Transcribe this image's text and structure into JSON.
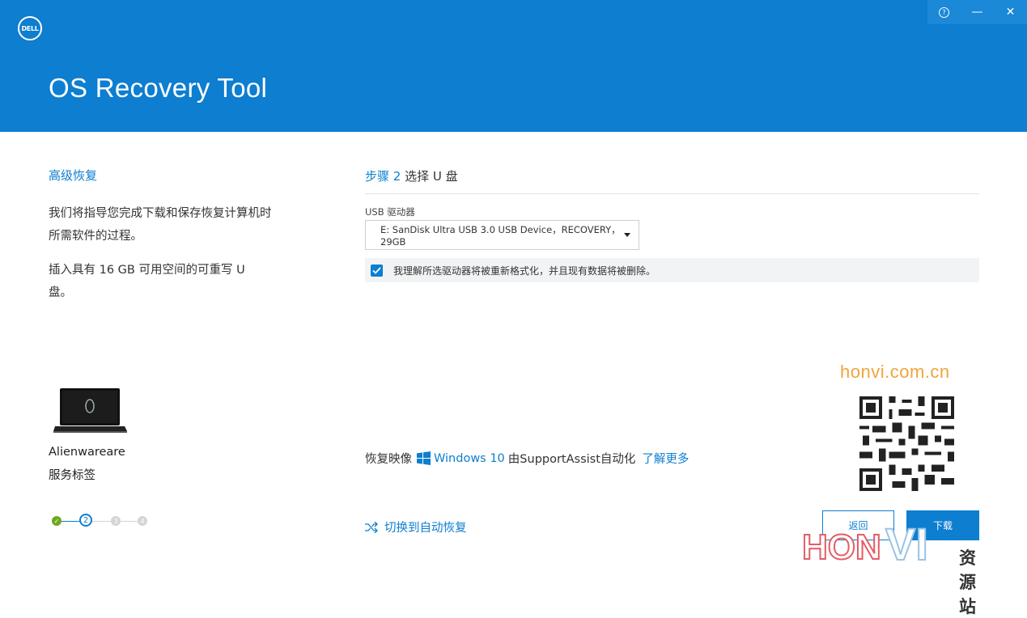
{
  "header": {
    "logo_text": "DELL",
    "app_title": "OS Recovery Tool",
    "help_glyph": "?",
    "minimize_glyph": "—",
    "close_glyph": "✕"
  },
  "left": {
    "heading": "高级恢复",
    "paragraph1": "我们将指导您完成下载和保存恢复计算机时所需软件的过程。",
    "paragraph2": "插入具有 16 GB 可用空间的可重写 U 盘。",
    "device_name": "Alienwareare",
    "service_tag": "服务标签"
  },
  "stepper": {
    "steps": [
      "✓",
      "2",
      "3",
      "4"
    ],
    "current_step": 2,
    "done_color": "#6ea820",
    "active_color": "#0d7ed0"
  },
  "main": {
    "step_num": "步骤 2",
    "step_title": "选择 U 盘",
    "usb_label": "USB 驱动器",
    "usb_selected": "E: SanDisk Ultra USB 3.0 USB Device，RECOVERY，29GB",
    "confirm_text": "我理解所选驱动器将被重新格式化，并且现有数据将被删除。",
    "confirm_checked": true,
    "recovery_prefix": "恢复映像",
    "recovery_os": "Windows 10",
    "recovery_suffix": "由SupportAssist自动化",
    "learn_more": "了解更多",
    "switch_link": "切换到自动恢复"
  },
  "buttons": {
    "back": "返回",
    "download": "下载"
  },
  "watermark": {
    "site": "honvi.com.cn",
    "brand_left": "HON",
    "brand_right": "VI",
    "brand_suffix": "资源站"
  },
  "colors": {
    "header_bg": "#0d7ed0",
    "accent": "#0d7ed0",
    "watermark_orange": "#f0a43c"
  }
}
